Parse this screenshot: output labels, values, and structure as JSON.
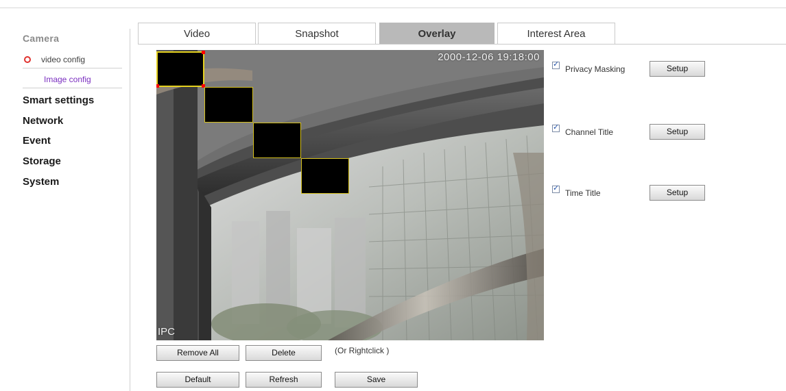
{
  "sidebar": {
    "section_title": "Camera",
    "sub_items": [
      {
        "label": "video config"
      },
      {
        "label": "Image config"
      }
    ],
    "menu": [
      {
        "label": "Smart settings"
      },
      {
        "label": "Network"
      },
      {
        "label": "Event"
      },
      {
        "label": "Storage"
      },
      {
        "label": "System"
      }
    ]
  },
  "tabs": [
    {
      "label": "Video"
    },
    {
      "label": "Snapshot"
    },
    {
      "label": "Overlay",
      "active": true
    },
    {
      "label": "Interest Area"
    }
  ],
  "preview": {
    "timestamp": "2000-12-06 19:18:00",
    "channel_osd": "IPC",
    "mask_count": 4
  },
  "options": [
    {
      "label": "Privacy Masking",
      "checked": true,
      "button": "Setup"
    },
    {
      "label": "Channel Title",
      "checked": true,
      "button": "Setup"
    },
    {
      "label": "Time Title",
      "checked": true,
      "button": "Setup"
    }
  ],
  "actions": {
    "remove_all": "Remove All",
    "delete": "Delete",
    "hint": "(Or Rightclick )",
    "default": "Default",
    "refresh": "Refresh",
    "save": "Save"
  },
  "colors": {
    "active_tab": "#b9b9b9",
    "mask_border": "#d8c21d",
    "selected_handle": "#ff0000",
    "sub_item_active": "#7b2fc0",
    "bullet": "#e0322e"
  }
}
